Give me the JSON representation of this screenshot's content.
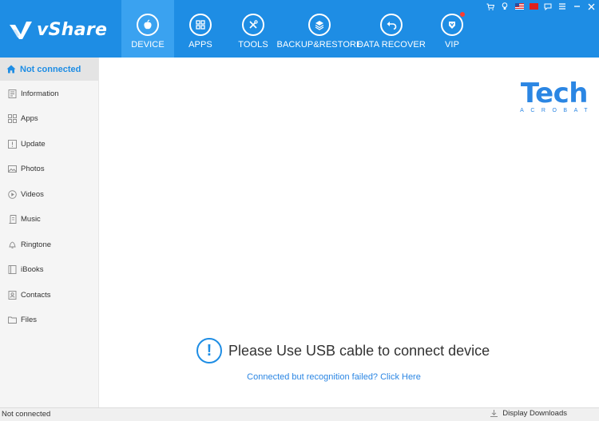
{
  "brand": {
    "name": "vShare"
  },
  "nav": [
    {
      "label": "DEVICE",
      "icon": "apple-icon",
      "active": true
    },
    {
      "label": "APPS",
      "icon": "apps-grid-icon",
      "active": false
    },
    {
      "label": "TOOLS",
      "icon": "tools-icon",
      "active": false
    },
    {
      "label": "BACKUP&RESTORE",
      "icon": "layers-icon",
      "active": false
    },
    {
      "label": "DATA RECOVER",
      "icon": "undo-icon",
      "active": false
    },
    {
      "label": "VIP",
      "icon": "vip-crown-icon",
      "active": false
    }
  ],
  "window_controls": [
    "cart-icon",
    "bulb-icon",
    "flag-us-icon",
    "flag-cn-icon",
    "chat-icon",
    "menu-icon",
    "minimize-icon",
    "close-icon"
  ],
  "sidebar": {
    "header": "Not connected",
    "items": [
      {
        "label": "Information",
        "icon": "information-icon"
      },
      {
        "label": "Apps",
        "icon": "apps-icon"
      },
      {
        "label": "Update",
        "icon": "update-icon"
      },
      {
        "label": "Photos",
        "icon": "photos-icon"
      },
      {
        "label": "Videos",
        "icon": "videos-icon"
      },
      {
        "label": "Music",
        "icon": "music-icon"
      },
      {
        "label": "Ringtone",
        "icon": "ringtone-icon"
      },
      {
        "label": "iBooks",
        "icon": "ibooks-icon"
      },
      {
        "label": "Contacts",
        "icon": "contacts-icon"
      },
      {
        "label": "Files",
        "icon": "files-icon"
      }
    ]
  },
  "main": {
    "watermark": {
      "title": "Tech",
      "subtitle": "ACROBAT"
    },
    "message": "Please Use USB cable to connect device",
    "alert_symbol": "!",
    "recognition_link": "Connected but recognition failed? Click Here"
  },
  "statusbar": {
    "status": "Not connected",
    "downloads_label": "Display Downloads"
  },
  "colors": {
    "header": "#1e8de4",
    "active_tab": "#3aa2f0",
    "accent": "#1e8de4",
    "sidebar_bg": "#f5f5f5",
    "link": "#2b86e3"
  }
}
